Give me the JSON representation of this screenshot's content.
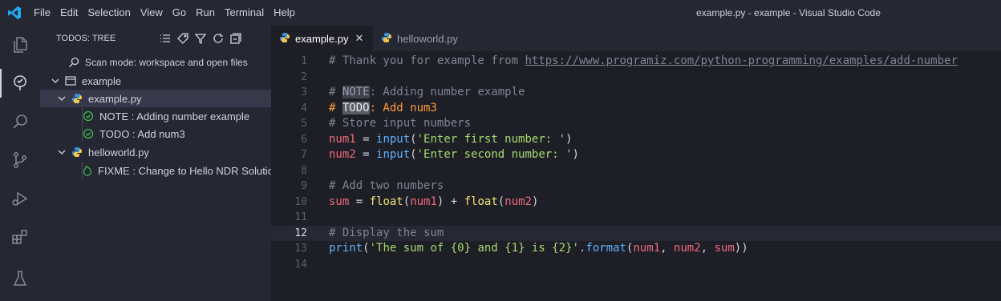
{
  "window": {
    "title": "example.py - example - Visual Studio Code",
    "menu": [
      "File",
      "Edit",
      "Selection",
      "View",
      "Go",
      "Run",
      "Terminal",
      "Help"
    ]
  },
  "sidebar": {
    "title": "TODOS: TREE",
    "scan_mode": "Scan mode: workspace and open files",
    "folder": "example",
    "files": [
      {
        "name": "example.py",
        "items": [
          "NOTE : Adding number example",
          "TODO : Add num3"
        ]
      },
      {
        "name": "helloworld.py",
        "items": [
          "FIXME : Change to Hello NDR Solutio"
        ]
      }
    ]
  },
  "tabs": [
    {
      "label": "example.py",
      "active": true
    },
    {
      "label": "helloworld.py",
      "active": false
    }
  ],
  "editor": {
    "current_line": 12,
    "lines": [
      {
        "n": "1",
        "text": "# Thank you for example from https://www.programiz.com/python-programming/examples/add-number"
      },
      {
        "n": "2",
        "text": ""
      },
      {
        "n": "3",
        "text": "# NOTE: Adding number example"
      },
      {
        "n": "4",
        "text": "# TODO: Add num3"
      },
      {
        "n": "5",
        "text": "# Store input numbers"
      },
      {
        "n": "6",
        "text": "num1 = input('Enter first number: ')"
      },
      {
        "n": "7",
        "text": "num2 = input('Enter second number: ')"
      },
      {
        "n": "8",
        "text": ""
      },
      {
        "n": "9",
        "text": "# Add two numbers"
      },
      {
        "n": "10",
        "text": "sum = float(num1) + float(num2)"
      },
      {
        "n": "11",
        "text": ""
      },
      {
        "n": "12",
        "text": "# Display the sum"
      },
      {
        "n": "13",
        "text": "print('The sum of {0} and {1} is {2}'.format(num1, num2, sum))"
      },
      {
        "n": "14",
        "text": ""
      }
    ]
  },
  "colors": {
    "accent": "#23a9f2",
    "todo_check": "#3fb950",
    "fixme_flame": "#3fb950"
  }
}
